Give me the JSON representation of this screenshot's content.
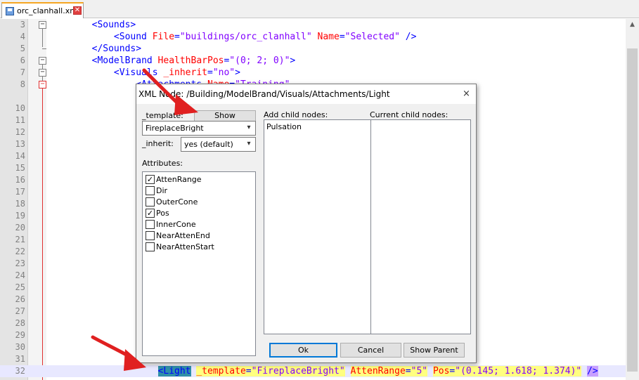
{
  "tab": {
    "filename": "orc_clanhall.xml",
    "save_icon": "save-icon",
    "close_icon": "close-icon",
    "close_glyph": "✕",
    "accent_color": "#f5a623"
  },
  "editor": {
    "lines": [
      {
        "num": "3"
      },
      {
        "num": "4"
      },
      {
        "num": "5"
      },
      {
        "num": "6"
      },
      {
        "num": "7"
      },
      {
        "num": "8"
      },
      {
        "num": "10"
      },
      {
        "num": "11"
      },
      {
        "num": "12"
      },
      {
        "num": "13"
      },
      {
        "num": "14"
      },
      {
        "num": "15"
      },
      {
        "num": "16"
      },
      {
        "num": "17"
      },
      {
        "num": "18"
      },
      {
        "num": "19"
      },
      {
        "num": "20"
      },
      {
        "num": "21"
      },
      {
        "num": "22"
      },
      {
        "num": "23"
      },
      {
        "num": "24"
      },
      {
        "num": "25"
      },
      {
        "num": "26"
      },
      {
        "num": "27"
      },
      {
        "num": "28"
      },
      {
        "num": "29"
      },
      {
        "num": "30"
      },
      {
        "num": "31"
      },
      {
        "num": "32"
      }
    ],
    "code": {
      "l3_tag": "<Sounds>",
      "l4_open": "<Sound",
      "l4_attr1": "File",
      "l4_eq": "=",
      "l4_val1": "\"buildings/orc_clanhall\"",
      "l4_attr2": "Name",
      "l4_val2": "\"Selected\"",
      "l4_close": "/>",
      "l5_tag": "</Sounds>",
      "l6_open": "<ModelBrand",
      "l6_attr": "HealthBarPos",
      "l6_val": "\"(0; 2; 0)\"",
      "l6_close": ">",
      "l7_open": "<Visuals",
      "l7_attr": "_inherit",
      "l7_val": "\"no\"",
      "l7_close": ">",
      "l8_open": "<Attachments",
      "l8_attr": "Name",
      "l8_val": "\"Training\"",
      "l32_tag": "<Light",
      "l32_attr1": "_template",
      "l32_val1": "\"FireplaceBright\"",
      "l32_attr2": "AttenRange",
      "l32_val2": "\"5\"",
      "l32_attr3": "Pos",
      "l32_val3": "\"(0.145; 1.618; 1.374)\"",
      "l32_close": "/>"
    },
    "colors": {
      "tag": "#0000ff",
      "attr": "#ff0000",
      "value": "#8000ff",
      "current_line": "#e8e8ff"
    }
  },
  "dialog": {
    "title": "XML Node: /Building/ModelBrand/Visuals/Attachments/Light",
    "close_glyph": "×",
    "template_label": "_template:",
    "show_button": "Show",
    "template_value": "FireplaceBright",
    "inherit_label": "_inherit:",
    "inherit_value": "yes (default)",
    "attributes_label": "Attributes:",
    "attributes": [
      {
        "name": "AttenRange",
        "checked": true
      },
      {
        "name": "Dir",
        "checked": false
      },
      {
        "name": "OuterCone",
        "checked": false
      },
      {
        "name": "Pos",
        "checked": true
      },
      {
        "name": "InnerCone",
        "checked": false
      },
      {
        "name": "NearAttenEnd",
        "checked": false
      },
      {
        "name": "NearAttenStart",
        "checked": false
      }
    ],
    "add_child_label": "Add child nodes:",
    "add_child_items": [
      "Pulsation"
    ],
    "current_child_label": "Current child nodes:",
    "ok_button": "Ok",
    "cancel_button": "Cancel",
    "show_parent_button": "Show Parent",
    "check_glyph": "✓",
    "chevron_glyph": "▾"
  },
  "annotations": {
    "arrow_color": "#e02020"
  }
}
